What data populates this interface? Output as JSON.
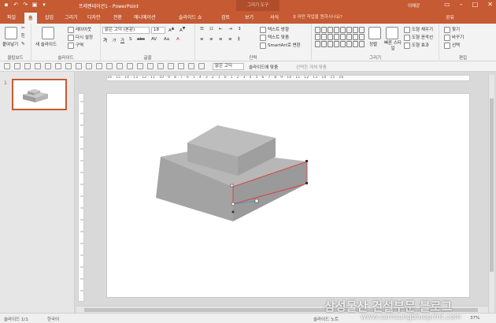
{
  "titlebar": {
    "doc_title": "프레젠테이션1 - PowerPoint",
    "context_tab": "그리기 도구",
    "user": "이예강"
  },
  "tabs": {
    "file": "파일",
    "home": "홈",
    "insert": "삽입",
    "design": "그리기",
    "design2": "디자인",
    "transitions": "전환",
    "animations": "애니메이션",
    "slideshow": "슬라이드 쇼",
    "review": "검토",
    "view": "보기",
    "format": "서식",
    "tellme": "♀ 어떤 작업을 원하시나요?",
    "share": "공유"
  },
  "ribbon": {
    "clipboard": {
      "paste": "붙여넣기",
      "label": "클립보드"
    },
    "slides": {
      "new_slide": "새 슬라이드",
      "layout": "레이아웃",
      "reset": "다시 설정",
      "section": "구역",
      "label": "슬라이드"
    },
    "font": {
      "name": "맑은 고딕 (본문)",
      "size": "18",
      "label": "글꼴"
    },
    "paragraph": {
      "text_direction": "텍스트 방향",
      "align_text": "텍스트 맞춤",
      "smartart": "SmartArt로 변환",
      "label": "단락"
    },
    "drawing": {
      "arrange": "정렬",
      "quick_styles": "빠른 스타일",
      "fill": "도형 채우기",
      "outline": "도형 윤곽선",
      "effects": "도형 효과",
      "label": "그리기"
    },
    "editing": {
      "find": "찾기",
      "replace": "바꾸기",
      "select": "선택",
      "label": "편집"
    }
  },
  "toolbar2": {
    "font": "맑은 고딕",
    "fit": "슬라이드에 맞춤",
    "select_objects": "선택한 개체 맞춤"
  },
  "slides_panel": {
    "number": "1"
  },
  "ruler": {
    "h": "16 · 15 · 14 · 13 · 12 · 11 · 10 · 9 · 8 · 7 · 6 · 5 · 4 · 3 · 2 · 1 · 0 · 1 · 2 · 3 · 4 · 5 · 6 · 7 · 8 · 9 · 10 · 11 · 12 · 13 · 14 · 15 · 16"
  },
  "status": {
    "slide": "슬라이드 1/1",
    "language": "한국어",
    "notes": "슬라이드 노트",
    "zoom": "37%"
  },
  "watermark": {
    "text": "삼성물산 건설부문 블로그",
    "url": "www.samsungblueprint.com"
  },
  "colors": {
    "accent": "#c55a33",
    "shape": "#a4a4a4"
  }
}
